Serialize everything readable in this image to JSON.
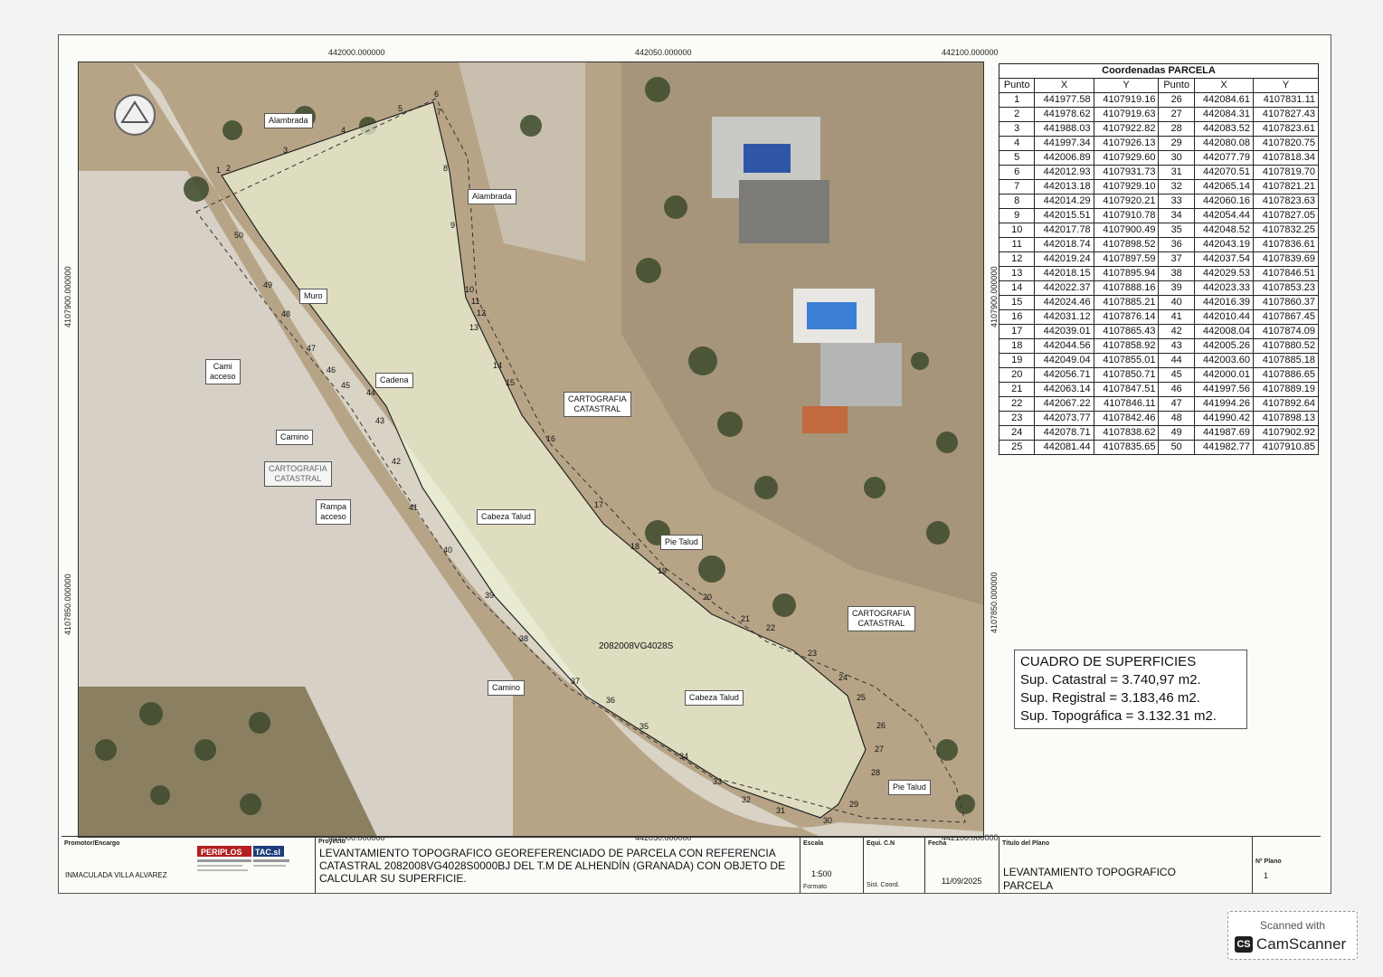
{
  "grid_labels": {
    "top": [
      "442000.000000",
      "442050.000000",
      "442100.000000"
    ],
    "bottom": [
      "442000.000000",
      "442050.000000",
      "442100.000000"
    ],
    "left": [
      "4107900.000000",
      "4107850.000000"
    ],
    "right": [
      "4107900.000000",
      "4107850.000000"
    ]
  },
  "map_labels": {
    "alambrada_1": "Alambrada",
    "alambrada_2": "Alambrada",
    "muro": "Muro",
    "cami_acceso": "Cami\nacceso",
    "cadena": "Cadena",
    "camino_1": "Camino",
    "cartografia_1": "CARTOGRAFIA\nCATASTRAL",
    "rampa_acceso": "Rampa\nacceso",
    "cabeza_talud_1": "Cabeza Talud",
    "cartografia_2": "CARTOGRAFIA\nCATASTRAL",
    "pie_talud_1": "Pie Talud",
    "cartografia_3": "CARTOGRAFIA\nCATASTRAL",
    "parcel_ref": "2082008VG4028S",
    "camino_2": "Camino",
    "cabeza_talud_2": "Cabeza Talud",
    "pie_talud_2": "Pie Talud"
  },
  "point_numbers": [
    "1",
    "2",
    "3",
    "4",
    "5",
    "6",
    "7",
    "8",
    "9",
    "10",
    "11",
    "12",
    "13",
    "14",
    "15",
    "16",
    "17",
    "18",
    "19",
    "20",
    "21",
    "22",
    "23",
    "24",
    "25",
    "26",
    "27",
    "28",
    "29",
    "30",
    "31",
    "32",
    "33",
    "34",
    "35",
    "36",
    "37",
    "38",
    "39",
    "40",
    "41",
    "42",
    "43",
    "44",
    "45",
    "46",
    "47",
    "48",
    "49",
    "50"
  ],
  "coords_table": {
    "title": "Coordenadas PARCELA",
    "headers": [
      "Punto",
      "X",
      "Y",
      "Punto",
      "X",
      "Y"
    ],
    "rows": [
      [
        "1",
        "441977.58",
        "4107919.16",
        "26",
        "442084.61",
        "4107831.11"
      ],
      [
        "2",
        "441978.62",
        "4107919.63",
        "27",
        "442084.31",
        "4107827.43"
      ],
      [
        "3",
        "441988.03",
        "4107922.82",
        "28",
        "442083.52",
        "4107823.61"
      ],
      [
        "4",
        "441997.34",
        "4107926.13",
        "29",
        "442080.08",
        "4107820.75"
      ],
      [
        "5",
        "442006.89",
        "4107929.60",
        "30",
        "442077.79",
        "4107818.34"
      ],
      [
        "6",
        "442012.93",
        "4107931.73",
        "31",
        "442070.51",
        "4107819.70"
      ],
      [
        "7",
        "442013.18",
        "4107929.10",
        "32",
        "442065.14",
        "4107821.21"
      ],
      [
        "8",
        "442014.29",
        "4107920.21",
        "33",
        "442060.16",
        "4107823.63"
      ],
      [
        "9",
        "442015.51",
        "4107910.78",
        "34",
        "442054.44",
        "4107827.05"
      ],
      [
        "10",
        "442017.78",
        "4107900.49",
        "35",
        "442048.52",
        "4107832.25"
      ],
      [
        "11",
        "442018.74",
        "4107898.52",
        "36",
        "442043.19",
        "4107836.61"
      ],
      [
        "12",
        "442019.24",
        "4107897.59",
        "37",
        "442037.54",
        "4107839.69"
      ],
      [
        "13",
        "442018.15",
        "4107895.94",
        "38",
        "442029.53",
        "4107846.51"
      ],
      [
        "14",
        "442022.37",
        "4107888.16",
        "39",
        "442023.33",
        "4107853.23"
      ],
      [
        "15",
        "442024.46",
        "4107885.21",
        "40",
        "442016.39",
        "4107860.37"
      ],
      [
        "16",
        "442031.12",
        "4107876.14",
        "41",
        "442010.44",
        "4107867.45"
      ],
      [
        "17",
        "442039.01",
        "4107865.43",
        "42",
        "442008.04",
        "4107874.09"
      ],
      [
        "18",
        "442044.56",
        "4107858.92",
        "43",
        "442005.26",
        "4107880.52"
      ],
      [
        "19",
        "442049.04",
        "4107855.01",
        "44",
        "442003.60",
        "4107885.18"
      ],
      [
        "20",
        "442056.71",
        "4107850.71",
        "45",
        "442000.01",
        "4107886.65"
      ],
      [
        "21",
        "442063.14",
        "4107847.51",
        "46",
        "441997.56",
        "4107889.19"
      ],
      [
        "22",
        "442067.22",
        "4107846.11",
        "47",
        "441994.26",
        "4107892.64"
      ],
      [
        "23",
        "442073.77",
        "4107842.46",
        "48",
        "441990.42",
        "4107898.13"
      ],
      [
        "24",
        "442078.71",
        "4107838.62",
        "49",
        "441987.69",
        "4107902.92"
      ],
      [
        "25",
        "442081.44",
        "4107835.65",
        "50",
        "441982.77",
        "4107910.85"
      ]
    ]
  },
  "surfaces": {
    "title": "CUADRO DE SUPERFICIES",
    "catastral": "Sup. Catastral = 3.740,97 m2.",
    "registral": "Sup. Registral = 3.183,46 m2.",
    "topografica": "Sup. Topográfica = 3.132.31 m2."
  },
  "title_block": {
    "promotor_head": "Promotor/Encargo",
    "promotor": "INMACULADA VILLA ALVAREZ",
    "proyecto_head": "Proyecto",
    "proyecto": "LEVANTAMIENTO TOPOGRAFICO GEOREFERENCIADO DE PARCELA CON REFERENCIA CATASTRAL 2082008VG4028S0000BJ DEL T.M DE ALHENDÍN (GRANADA) CON OBJETO DE CALCULAR SU SUPERFICIE.",
    "escala_head": "Escala",
    "escala": "1:500",
    "formato_head": "Formato",
    "equi_head": "Equi. C.N",
    "sist_head": "Sist. Coord.",
    "fecha_head": "Fecha",
    "fecha": "11/09/2025",
    "titulo_head": "Título del Plano",
    "titulo": "LEVANTAMIENTO TOPOGRAFICO\nPARCELA",
    "nplano_head": "Nº Plano",
    "nplano": "1",
    "logo_text_1": "PERIPLOS",
    "logo_text_2": "TAC.sl"
  },
  "scanner": {
    "top": "Scanned with",
    "icon": "CS",
    "name": "CamScanner"
  },
  "colors": {
    "parcel_fill": "#eef2d6",
    "boundary": "#222222",
    "road": "#d7d2c4"
  }
}
